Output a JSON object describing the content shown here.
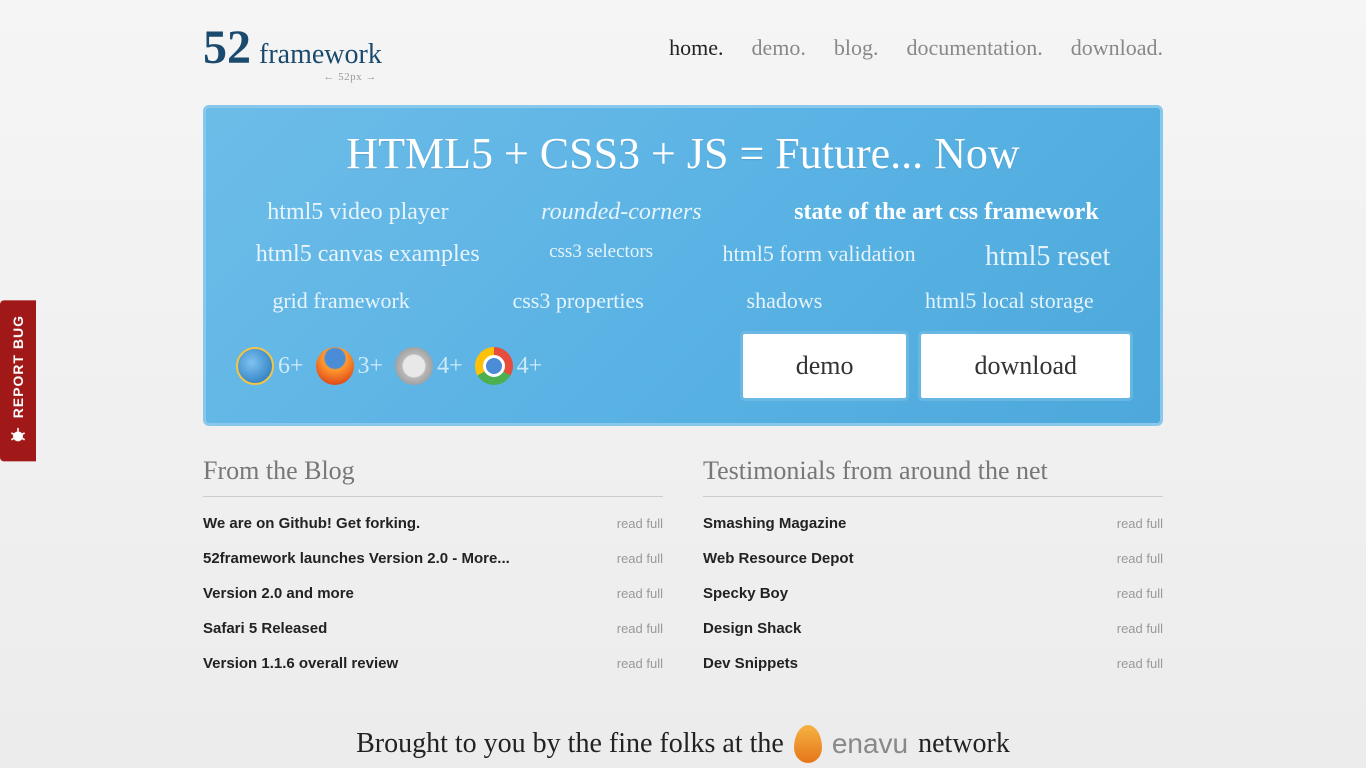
{
  "logo": {
    "num": "52",
    "text": "framework",
    "sub": "← 52px →"
  },
  "nav": [
    {
      "label": "home.",
      "active": true
    },
    {
      "label": "demo.",
      "active": false
    },
    {
      "label": "blog.",
      "active": false
    },
    {
      "label": "documentation.",
      "active": false
    },
    {
      "label": "download.",
      "active": false
    }
  ],
  "hero": {
    "title": "HTML5  +  CSS3  + JS = Future... Now",
    "features_row1": [
      "html5 video player",
      "rounded-corners",
      "state of the art css framework"
    ],
    "features_row2": [
      "html5 canvas examples",
      "css3 selectors",
      "html5 form validation",
      "html5 reset"
    ],
    "features_row3": [
      "grid framework",
      "css3 properties",
      "shadows",
      "html5 local storage"
    ],
    "browsers": [
      {
        "name": "ie",
        "ver": "6+"
      },
      {
        "name": "firefox",
        "ver": "3+"
      },
      {
        "name": "safari",
        "ver": "4+"
      },
      {
        "name": "chrome",
        "ver": "4+"
      }
    ],
    "buttons": {
      "demo": "demo",
      "download": "download"
    }
  },
  "blog": {
    "heading": "From the Blog",
    "read_full": "read full",
    "items": [
      "We are on Github! Get forking.",
      "52framework launches Version 2.0 - More...",
      "Version 2.0 and more",
      "Safari 5 Released",
      "Version 1.1.6 overall review"
    ]
  },
  "testimonials": {
    "heading": "Testimonials from around the net",
    "read_full": "read full",
    "items": [
      "Smashing Magazine",
      "Web Resource Depot",
      "Specky Boy",
      "Design Shack",
      "Dev Snippets"
    ]
  },
  "footer": {
    "prefix": "Brought to you by the fine folks at the",
    "brand": "enavu",
    "suffix": "network"
  },
  "report_bug": "REPORT BUG"
}
